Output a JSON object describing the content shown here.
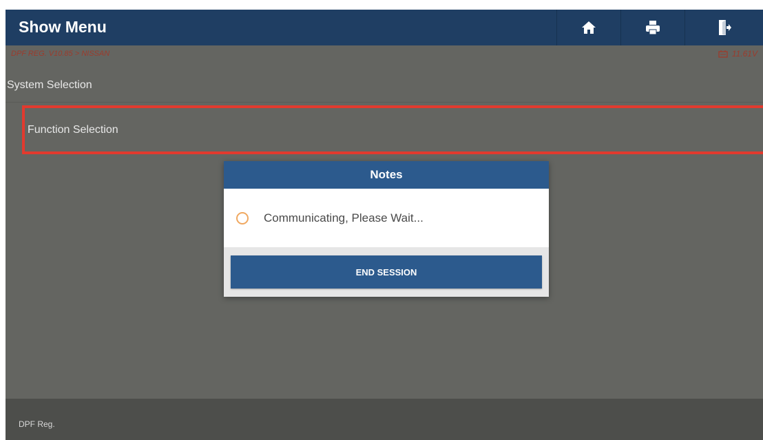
{
  "header": {
    "title": "Show Menu",
    "icons": [
      "home-icon",
      "print-icon",
      "exit-icon"
    ]
  },
  "breadcrumb": "DPF REG. V10.85 > NISSAN",
  "voltage": "11.61V",
  "menu": {
    "items": [
      {
        "label": "System Selection"
      },
      {
        "label": "Function Selection"
      }
    ]
  },
  "dialog": {
    "title": "Notes",
    "message": "Communicating, Please Wait...",
    "button": "END SESSION"
  },
  "footer": {
    "label": "DPF Reg."
  },
  "colors": {
    "header_bg": "#1f3e63",
    "content_bg": "#646561",
    "highlight": "#e23a2e",
    "dialog_accent": "#2c5a8d",
    "breadcrumb_text": "#9c3b2c",
    "spinner": "#f0a860"
  }
}
